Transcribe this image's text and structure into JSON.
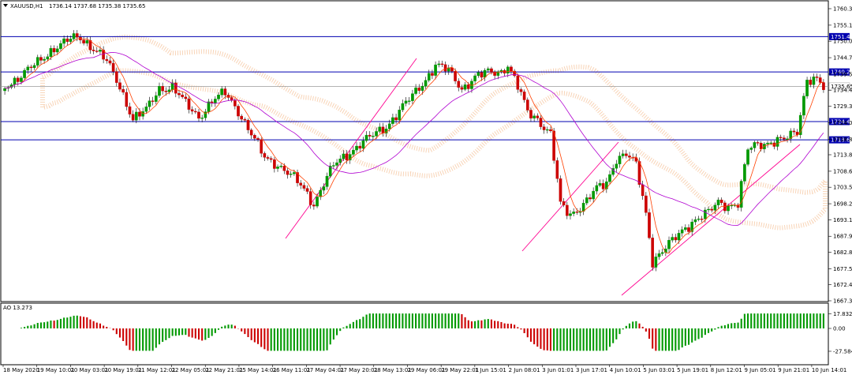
{
  "main_chart": {
    "header": {
      "symbol": "XAUUSD,H1",
      "ohlc": "1736.14 1737.68 1735.38 1735.65"
    },
    "y_ticks": [
      "1760.38",
      "1755.13",
      "1750.03",
      "1744.78",
      "1739.53",
      "1734.43",
      "1729.33",
      "1724.08",
      "1718.83",
      "1713.88",
      "1708.63",
      "1703.53",
      "1698.28",
      "1693.18",
      "1687.93",
      "1682.83",
      "1677.58",
      "1672.48",
      "1667.38"
    ],
    "y_tick_values": [
      1760.38,
      1755.13,
      1750.03,
      1744.78,
      1739.53,
      1734.43,
      1729.33,
      1724.08,
      1718.83,
      1713.88,
      1708.63,
      1703.53,
      1698.28,
      1693.18,
      1687.93,
      1682.83,
      1677.58,
      1672.48,
      1667.38
    ],
    "levels": [
      {
        "label": "1751.49",
        "value": 1751.49,
        "color": "#0000b0"
      },
      {
        "label": "1740.24",
        "value": 1740.24,
        "color": "#0000b0"
      },
      {
        "label": "1724.45",
        "value": 1724.45,
        "color": "#0000b0"
      },
      {
        "label": "1718.63",
        "value": 1718.63,
        "color": "#0000b0"
      }
    ],
    "price_line": {
      "label": "1735.65",
      "value": 1735.65,
      "color": "#9a9a9a"
    },
    "x_ticks": [
      "18 May 2020",
      "19 May 10:01",
      "20 May 03:01",
      "20 May 19:01",
      "21 May 12:01",
      "22 May 05:01",
      "22 May 21:01",
      "25 May 14:01",
      "26 May 11:01",
      "27 May 04:01",
      "27 May 20:01",
      "28 May 13:01",
      "29 May 06:01",
      "29 May 22:01",
      "1 Jun 15:01",
      "2 Jun 08:01",
      "3 Jun 01:01",
      "3 Jun 17:01",
      "4 Jun 10:01",
      "5 Jun 03:01",
      "5 Jun 19:01",
      "8 Jun 12:01",
      "9 Jun 05:01",
      "9 Jun 21:01",
      "10 Jun 14:01"
    ],
    "colors": {
      "bull": "#009900",
      "bear": "#cc0000",
      "fast_ma": "#ff4000",
      "slow_ma": "#b000d0",
      "cloud": "#f0a060",
      "trend": "#ff0090"
    }
  },
  "ao_panel": {
    "label": "AO 13.273",
    "y_ticks": [
      "17.832",
      "0.00",
      "-27.584"
    ],
    "y_tick_values": [
      17.832,
      0,
      -27.584
    ]
  }
}
